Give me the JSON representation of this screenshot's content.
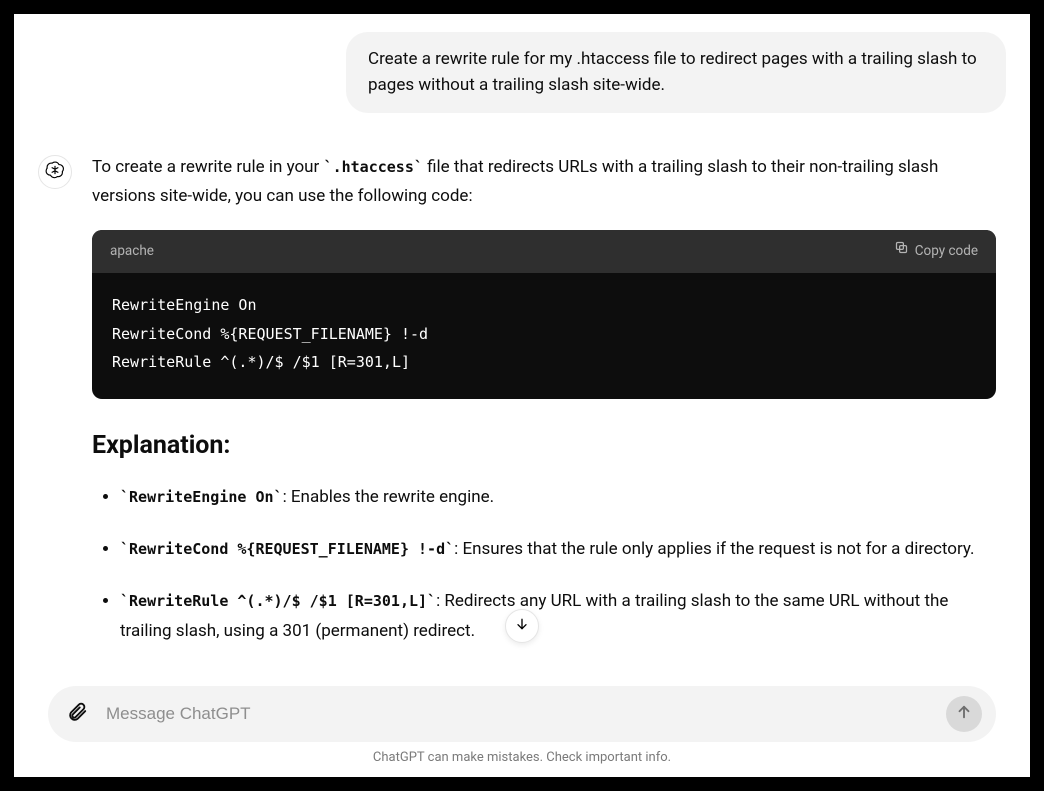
{
  "user_message": "Create a rewrite rule for my .htaccess file to redirect pages with a trailing slash to pages without a trailing slash site-wide.",
  "assistant": {
    "intro_before_code": "To create a rewrite rule in your ",
    "intro_code1": "`.htaccess`",
    "intro_after_code": " file that redirects URLs with a trailing slash to their non-trailing slash versions site-wide, you can use the following code:",
    "code_lang": "apache",
    "copy_label": "Copy code",
    "code_body": "RewriteEngine On\nRewriteCond %{REQUEST_FILENAME} !-d\nRewriteRule ^(.*)/$ /$1 [R=301,L]",
    "explanation_heading": "Explanation:",
    "bullets": [
      {
        "code": "`RewriteEngine On`",
        "text": ": Enables the rewrite engine."
      },
      {
        "code": "`RewriteCond %{REQUEST_FILENAME} !-d`",
        "text": ": Ensures that the rule only applies if the request is not for a directory."
      },
      {
        "code": "`RewriteRule ^(.*)/$ /$1 [R=301,L]`",
        "text": ": Redirects any URL with a trailing slash to the same URL without the trailing slash, using a 301 (permanent) redirect."
      }
    ]
  },
  "composer": {
    "placeholder": "Message ChatGPT"
  },
  "disclaimer": "ChatGPT can make mistakes. Check important info."
}
